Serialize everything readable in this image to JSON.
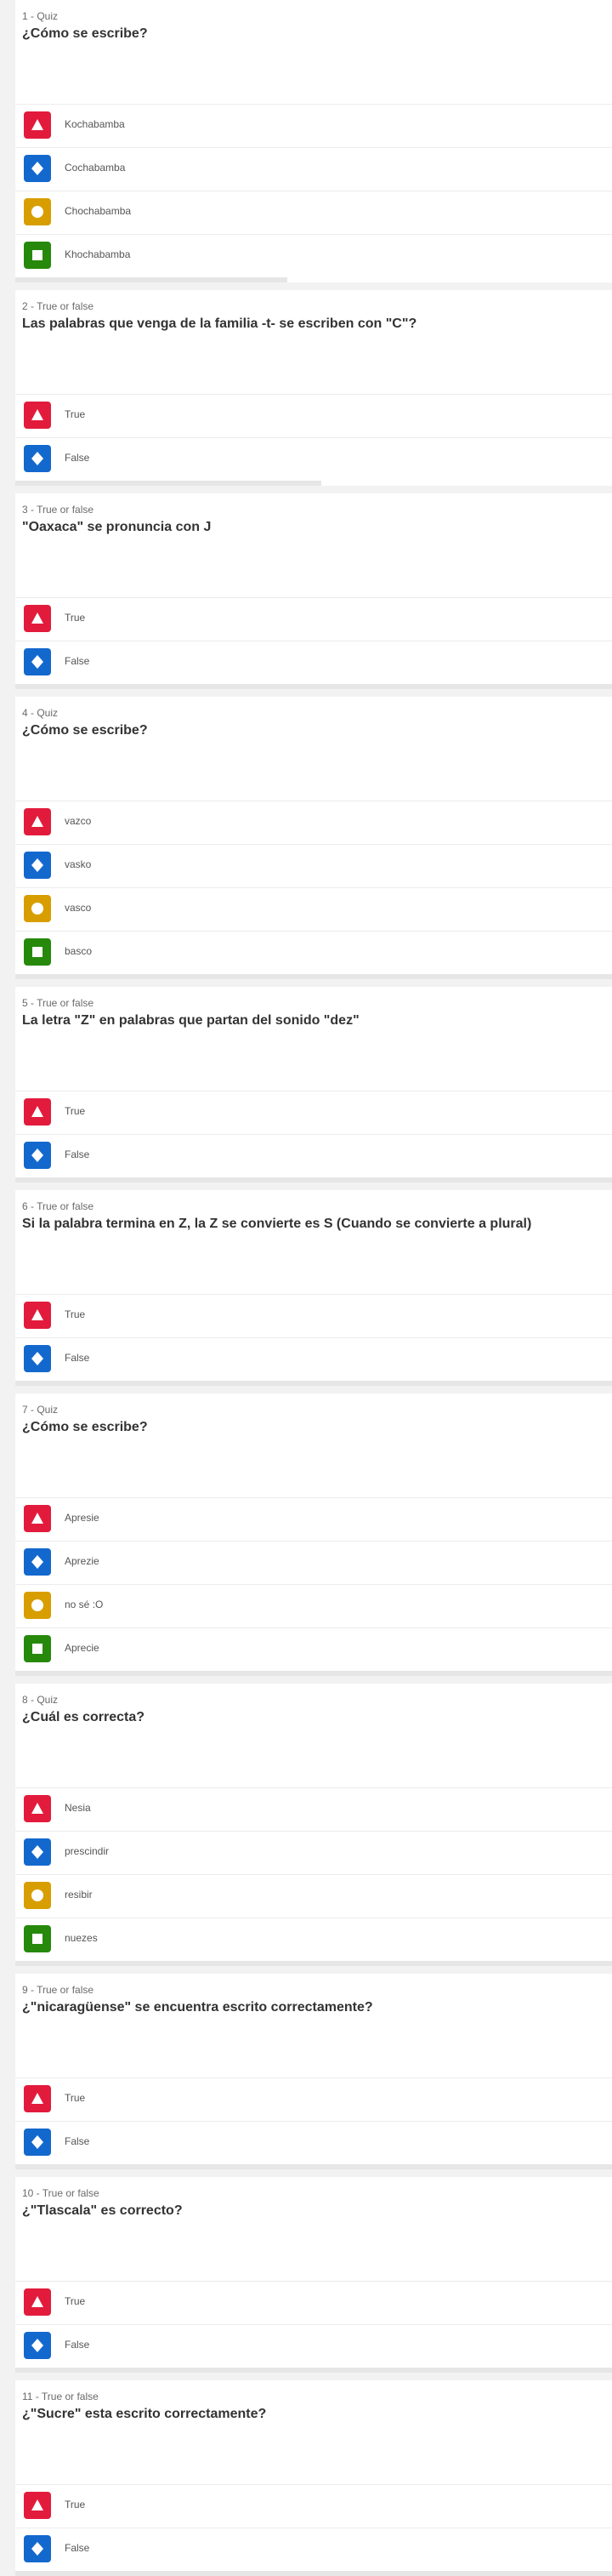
{
  "colors": {
    "red": "#e21b3c",
    "blue": "#1368ce",
    "yellow": "#d89e00",
    "green": "#26890c"
  },
  "icons": {
    "red": "triangle-icon",
    "blue": "diamond-icon",
    "yellow": "circle-icon",
    "green": "square-icon"
  },
  "questions": [
    {
      "type_label": "1 - Quiz",
      "title": "¿Cómo se escribe?",
      "answers": [
        "Kochabamba",
        "Cochabamba",
        "Chochabamba",
        "Khochabamba"
      ]
    },
    {
      "type_label": "2 - True or false",
      "title": "Las palabras que venga de la familia -t- se escriben con \"C\"?",
      "answers": [
        "True",
        "False"
      ]
    },
    {
      "type_label": "3 - True or false",
      "title": "\"Oaxaca\" se pronuncia con J",
      "answers": [
        "True",
        "False"
      ]
    },
    {
      "type_label": "4 - Quiz",
      "title": "¿Cómo se escribe?",
      "answers": [
        "vazco",
        "vasko",
        "vasco",
        "basco"
      ]
    },
    {
      "type_label": "5 - True or false",
      "title": "La letra \"Z\" en palabras que partan del sonido \"dez\"",
      "answers": [
        "True",
        "False"
      ]
    },
    {
      "type_label": "6 - True or false",
      "title": "Si la palabra termina en Z, la Z se convierte es S (Cuando se convierte a plural)",
      "answers": [
        "True",
        "False"
      ]
    },
    {
      "type_label": "7 - Quiz",
      "title": "¿Cómo se escribe?",
      "answers": [
        "Apresie",
        "Aprezie",
        "no sé :O",
        "Aprecie"
      ]
    },
    {
      "type_label": "8 - Quiz",
      "title": "¿Cuál es correcta?",
      "answers": [
        "Nesia",
        "prescindir",
        "resibir",
        "nuezes"
      ]
    },
    {
      "type_label": "9 - True or false",
      "title": "¿\"nicaragüense\" se encuentra escrito correctamente?",
      "answers": [
        "True",
        "False"
      ]
    },
    {
      "type_label": "10 - True or false",
      "title": "¿\"Tlascala\" es correcto?",
      "answers": [
        "True",
        "False"
      ]
    },
    {
      "type_label": "11 - True or false",
      "title": "¿\"Sucre\" esta escrito correctamente?",
      "answers": [
        "True",
        "False"
      ]
    }
  ]
}
